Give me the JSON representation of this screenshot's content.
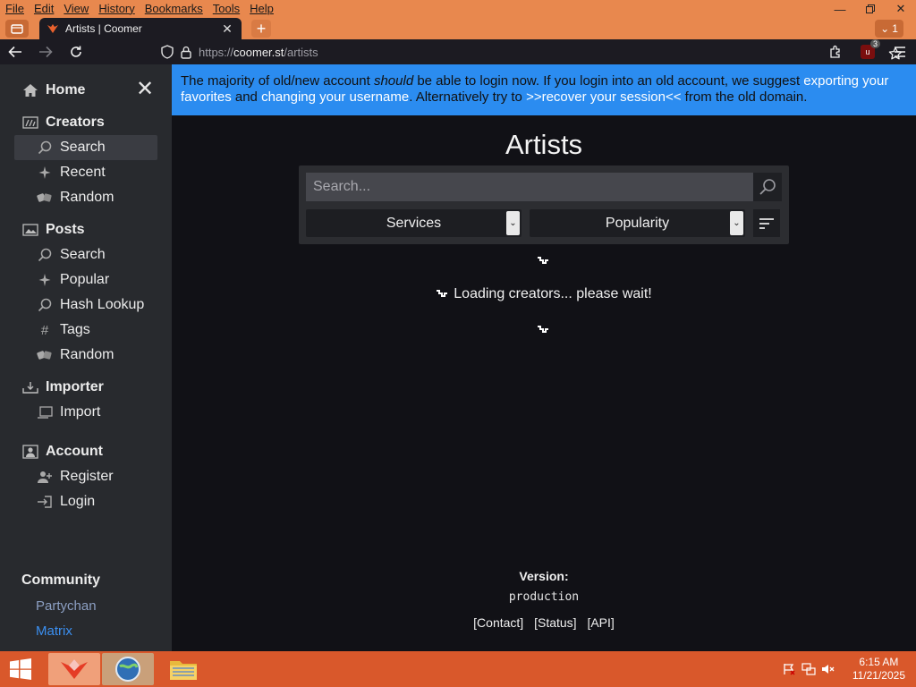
{
  "browser": {
    "menu": [
      "File",
      "Edit",
      "View",
      "History",
      "Bookmarks",
      "Tools",
      "Help"
    ],
    "tab_title": "Artists | Coomer",
    "url_scheme": "https://",
    "url_host": "coomer.st",
    "url_path": "/artists",
    "tablist_count": "1",
    "ublock_badge": "3"
  },
  "sidebar": {
    "home": "Home",
    "creators": {
      "title": "Creators",
      "items": [
        "Search",
        "Recent",
        "Random"
      ]
    },
    "posts": {
      "title": "Posts",
      "items": [
        "Search",
        "Popular",
        "Hash Lookup",
        "Tags",
        "Random"
      ]
    },
    "importer": {
      "title": "Importer",
      "items": [
        "Import"
      ]
    },
    "account": {
      "title": "Account",
      "items": [
        "Register",
        "Login"
      ]
    },
    "community": {
      "title": "Community",
      "links": [
        "Partychan",
        "Matrix"
      ]
    }
  },
  "notice": {
    "t1": "The majority of old/new account ",
    "t_em": "should",
    "t2": " be able to login now. If you login into an old account, we suggest ",
    "link1": "exporting your favorites",
    "t3": " and ",
    "link2": "changing your username",
    "t4": ". Alternatively try to ",
    "link3": ">>recover your session<<",
    "t5": " from the old domain."
  },
  "main": {
    "title": "Artists",
    "search_placeholder": "Search...",
    "services_select": "Services",
    "sort_select": "Popularity",
    "loading_text": "Loading creators... please wait!",
    "version_label": "Version:",
    "version_value": "production",
    "footer_links": [
      "[Contact]",
      "[Status]",
      "[API]"
    ]
  },
  "taskbar": {
    "time": "6:15 AM",
    "date": "11/21/2025"
  },
  "colors": {
    "accent": "#2b8cf0",
    "sidebar_bg": "#282a2e",
    "page_bg": "#111116",
    "browser_frame": "#e8884e",
    "taskbar": "#d9582b",
    "partychan_link": "#8c9fc2",
    "matrix_link": "#3b8ff0"
  }
}
